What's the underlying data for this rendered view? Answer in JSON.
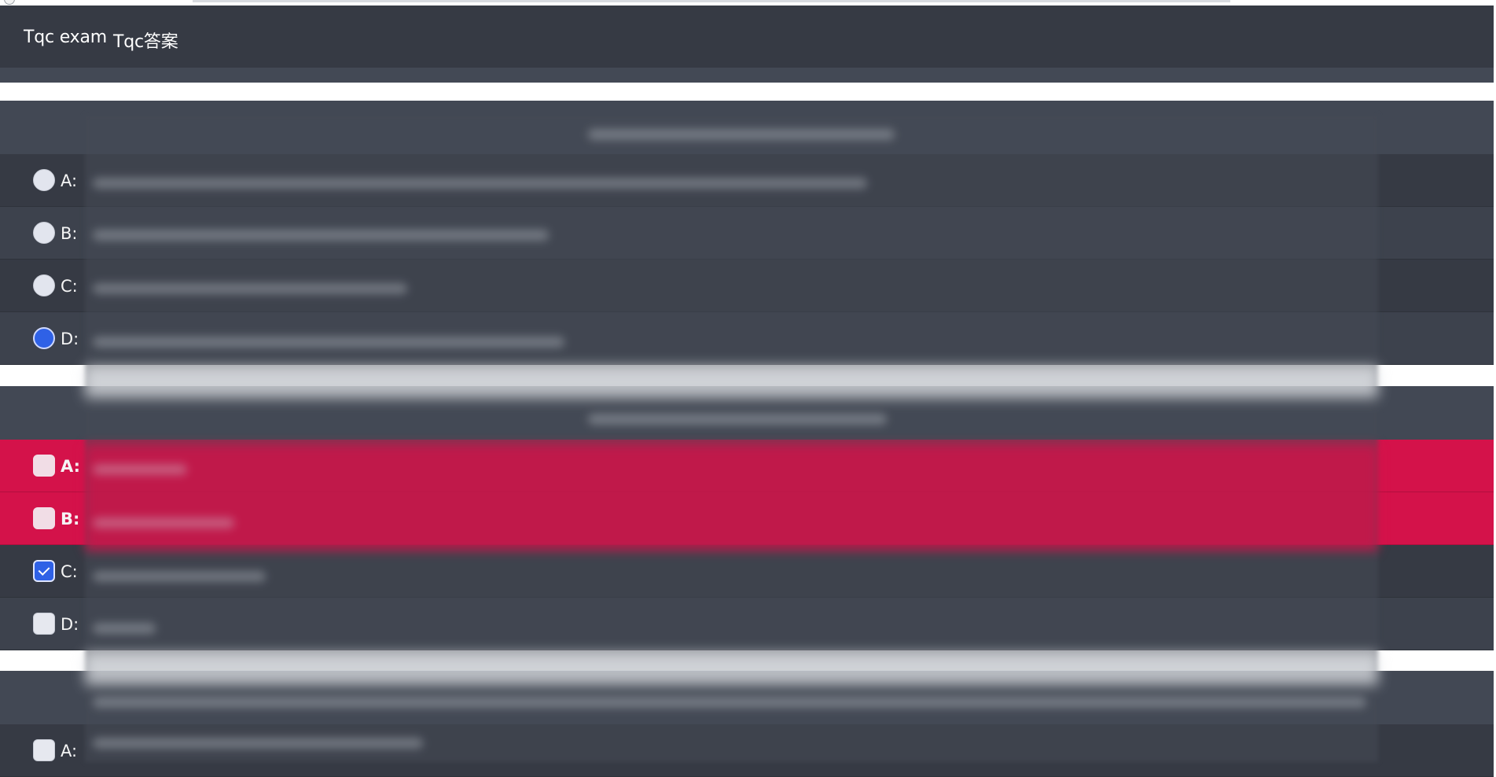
{
  "nav": {
    "links": [
      "Tqc exam",
      "Tqc答案"
    ]
  },
  "questions": [
    {
      "type": "radio",
      "options": [
        {
          "letter": "A:",
          "checked": false
        },
        {
          "letter": "B:",
          "checked": false
        },
        {
          "letter": "C:",
          "checked": false
        },
        {
          "letter": "D:",
          "checked": true
        }
      ]
    },
    {
      "type": "checkbox",
      "options": [
        {
          "letter": "A:",
          "checked": false,
          "state": "wrong"
        },
        {
          "letter": "B:",
          "checked": false,
          "state": "wrong"
        },
        {
          "letter": "C:",
          "checked": true
        },
        {
          "letter": "D:",
          "checked": false
        }
      ]
    },
    {
      "type": "checkbox",
      "options": [
        {
          "letter": "A:",
          "checked": false
        }
      ]
    }
  ],
  "colors": {
    "nav_bg": "#363a44",
    "wrong_bg": "#d4124a",
    "checked_accent": "#2f61e6"
  }
}
